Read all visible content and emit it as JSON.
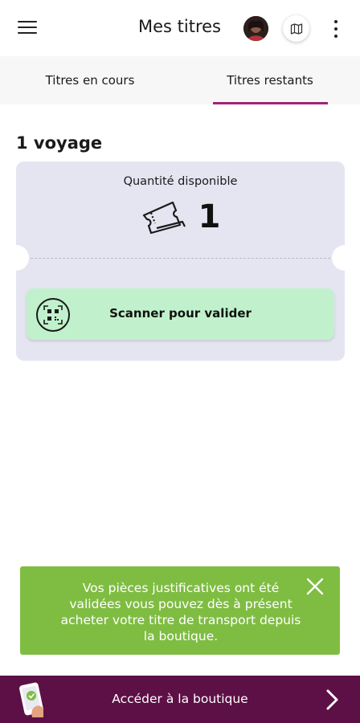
{
  "header": {
    "title": "Mes titres",
    "icons": {
      "menu": "hamburger-menu-icon",
      "avatar": "user-avatar",
      "map": "map-icon",
      "more": "more-vertical-icon"
    }
  },
  "tabs": [
    {
      "label": "Titres en cours",
      "active": false
    },
    {
      "label": "Titres restants",
      "active": true
    }
  ],
  "accent_color": "#a0237a",
  "main": {
    "section_title": "1 voyage",
    "ticket": {
      "quantity_label": "Quantité disponible",
      "quantity_value": "1",
      "quantity_icon": "ticket-icon",
      "scan_label": "Scanner pour valider",
      "scan_icon": "qr-scan-icon",
      "card_color": "#e4e5f1",
      "scan_button_color": "#c1f1cc"
    }
  },
  "toast": {
    "message": "Vos pièces justificatives ont été validées vous pouvez dès à présent acheter votre titre de transport depuis la boutique.",
    "color": "#7fbd42",
    "close_icon": "close-icon"
  },
  "bottom_bar": {
    "label": "Accéder à la boutique",
    "color": "#5d1046",
    "icons": {
      "shop": "phone-shop-icon",
      "chevron": "chevron-right-icon"
    }
  }
}
